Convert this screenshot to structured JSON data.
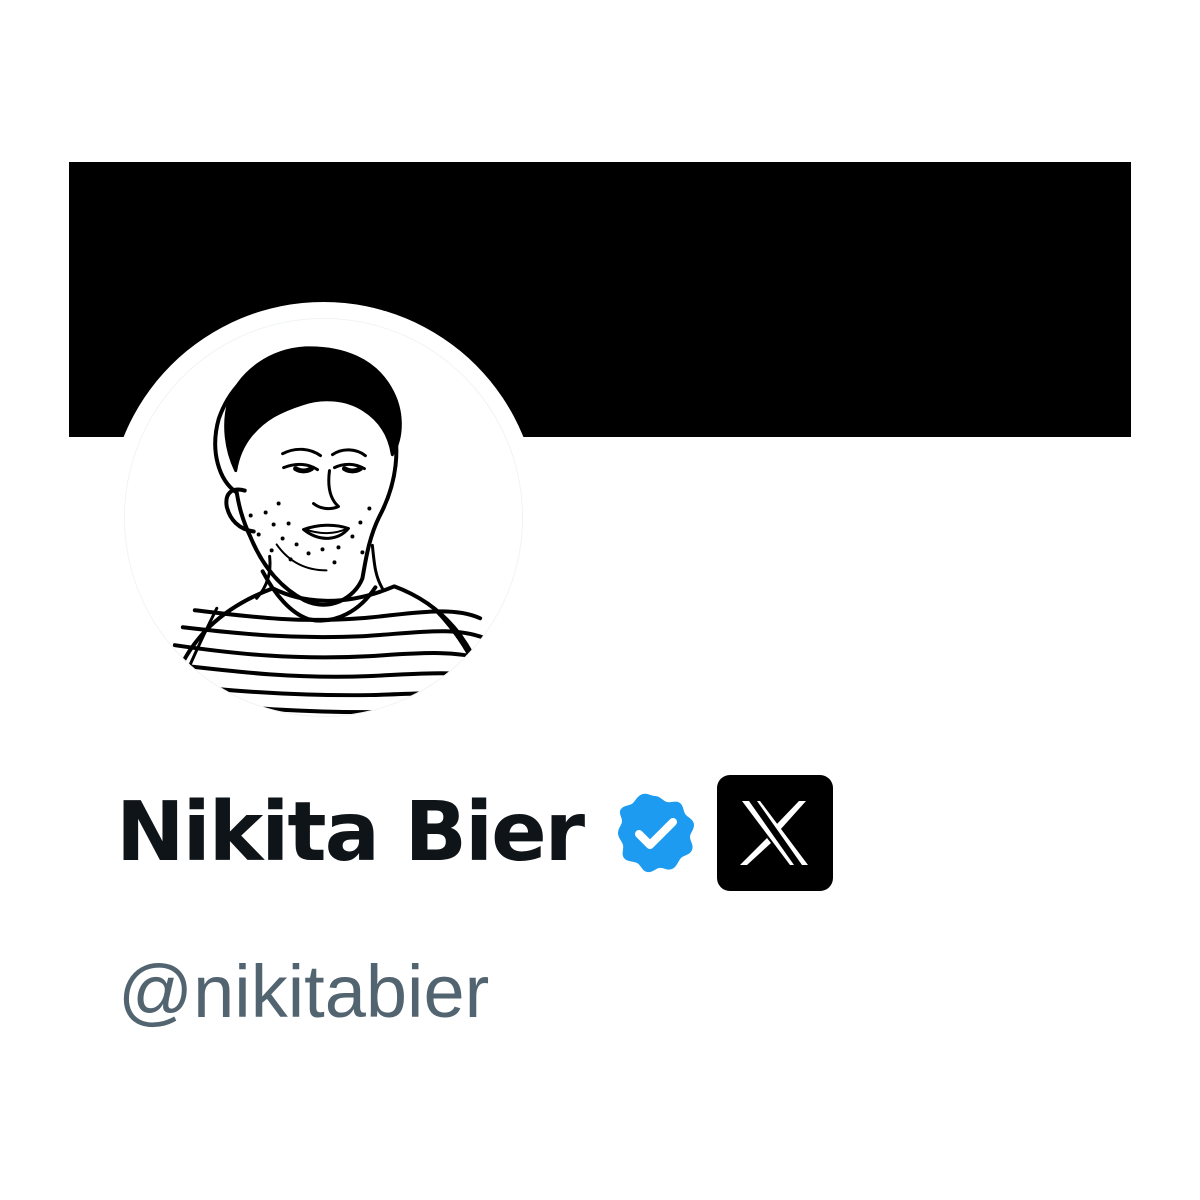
{
  "profile": {
    "display_name": "Nikita Bier",
    "handle": "@nikitabier",
    "verified_badge_icon": "verified-badge-icon",
    "affiliation_badge_icon": "x-logo-icon",
    "avatar_alt": "hand-drawn portrait avatar",
    "colors": {
      "banner": "#000000",
      "verified": "#1d9bf0",
      "name": "#0f1419",
      "handle": "#536471",
      "background": "#ffffff"
    }
  }
}
